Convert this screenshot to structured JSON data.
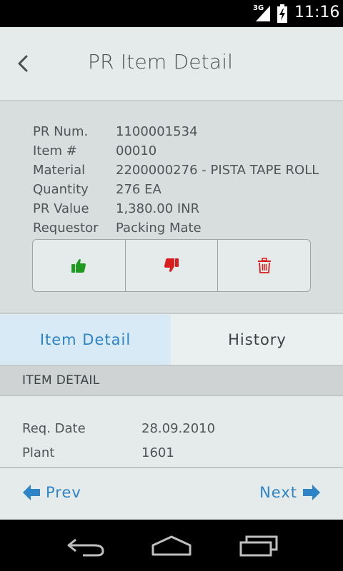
{
  "status_bar": {
    "network": "3G",
    "time": "11:16",
    "icons": [
      "signal-icon",
      "battery-icon"
    ]
  },
  "header": {
    "title": "PR Item Detail",
    "back_icon": "chevron-left-icon"
  },
  "summary": {
    "fields": [
      {
        "label": "PR Num.",
        "value": "1100001534"
      },
      {
        "label": "Item #",
        "value": "00010"
      },
      {
        "label": "Material",
        "value": "2200000276 - PISTA TAPE ROLL"
      },
      {
        "label": "Quantity",
        "value": "276 EA"
      },
      {
        "label": "PR Value",
        "value": "1,380.00 INR"
      },
      {
        "label": "Requestor",
        "value": "Packing Mate"
      }
    ],
    "actions": [
      {
        "icon": "thumbs-up-icon",
        "color": "#1e9a1e"
      },
      {
        "icon": "thumbs-down-icon",
        "color": "#d81f1f"
      },
      {
        "icon": "trash-icon",
        "color": "#d81f1f"
      }
    ]
  },
  "tabs": {
    "active": "Item Detail",
    "items": [
      {
        "label": "Item Detail"
      },
      {
        "label": "History"
      }
    ],
    "active_color": "#2d84c6"
  },
  "section": {
    "title": "ITEM DETAIL"
  },
  "details": [
    {
      "label": "Req. Date",
      "value": "28.09.2010"
    },
    {
      "label": "Plant",
      "value": "1601"
    }
  ],
  "footer": {
    "prev_label": "Prev",
    "next_label": "Next",
    "prev_icon": "arrow-left-icon",
    "next_icon": "arrow-right-icon"
  },
  "system_nav": {
    "icons": [
      "back-nav-icon",
      "home-nav-icon",
      "recents-nav-icon"
    ]
  }
}
